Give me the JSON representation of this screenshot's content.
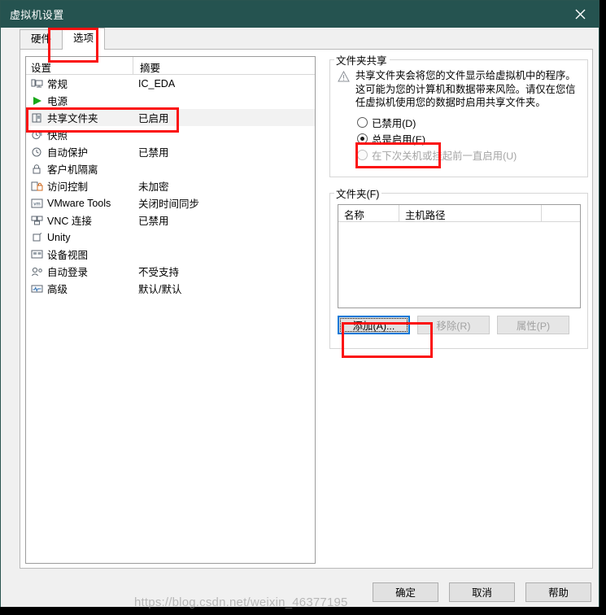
{
  "window": {
    "title": "虚拟机设置",
    "close_icon": "close-icon"
  },
  "tabs": [
    {
      "label": "硬件",
      "selected": false
    },
    {
      "label": "选项",
      "selected": true
    }
  ],
  "settings_list": {
    "headers": {
      "name": "设置",
      "summary": "摘要"
    },
    "rows": [
      {
        "icon": "monitor-icon",
        "label": "常规",
        "summary": "IC_EDA",
        "selected": false
      },
      {
        "icon": "power-play-icon",
        "label": "电源",
        "summary": "",
        "selected": false
      },
      {
        "icon": "shared-folder-icon",
        "label": "共享文件夹",
        "summary": "已启用",
        "selected": true
      },
      {
        "icon": "snapshot-clock-icon",
        "label": "快照",
        "summary": "",
        "selected": false
      },
      {
        "icon": "autoprotect-icon",
        "label": "自动保护",
        "summary": "已禁用",
        "selected": false
      },
      {
        "icon": "lock-icon",
        "label": "客户机隔离",
        "summary": "",
        "selected": false
      },
      {
        "icon": "access-control-icon",
        "label": "访问控制",
        "summary": "未加密",
        "selected": false
      },
      {
        "icon": "vmware-tools-icon",
        "label": "VMware Tools",
        "summary": "关闭时间同步",
        "selected": false
      },
      {
        "icon": "vnc-icon",
        "label": "VNC 连接",
        "summary": "已禁用",
        "selected": false
      },
      {
        "icon": "unity-icon",
        "label": "Unity",
        "summary": "",
        "selected": false
      },
      {
        "icon": "device-view-icon",
        "label": "设备视图",
        "summary": "",
        "selected": false
      },
      {
        "icon": "autologin-icon",
        "label": "自动登录",
        "summary": "不受支持",
        "selected": false
      },
      {
        "icon": "advanced-icon",
        "label": "高级",
        "summary": "默认/默认",
        "selected": false
      }
    ]
  },
  "folder_sharing": {
    "legend": "文件夹共享",
    "warning_icon": "warning-triangle-icon",
    "warning_text": "共享文件夹会将您的文件显示给虚拟机中的程序。这可能为您的计算机和数据带来风险。请仅在您信任虚拟机使用您的数据时启用共享文件夹。",
    "options": [
      {
        "label": "已禁用(D)",
        "checked": false,
        "disabled": false
      },
      {
        "label": "总是启用(E)",
        "checked": true,
        "disabled": false
      },
      {
        "label": "在下次关机或挂起前一直启用(U)",
        "checked": false,
        "disabled": true
      }
    ]
  },
  "folders": {
    "legend": "文件夹(F)",
    "columns": [
      "名称",
      "主机路径",
      ""
    ],
    "rows": [],
    "buttons": [
      {
        "label": "添加(A)...",
        "disabled": false,
        "focused": true
      },
      {
        "label": "移除(R)",
        "disabled": true,
        "focused": false
      },
      {
        "label": "属性(P)",
        "disabled": true,
        "focused": false
      }
    ]
  },
  "dialog_buttons": [
    {
      "label": "确定"
    },
    {
      "label": "取消"
    },
    {
      "label": "帮助"
    }
  ],
  "watermark": "https://blog.csdn.net/weixin_46377195",
  "colors": {
    "titlebar": "#255350",
    "annotation_red": "#fb1111",
    "focus_blue": "#0078d7",
    "selected_row": "#f2f2f2"
  }
}
